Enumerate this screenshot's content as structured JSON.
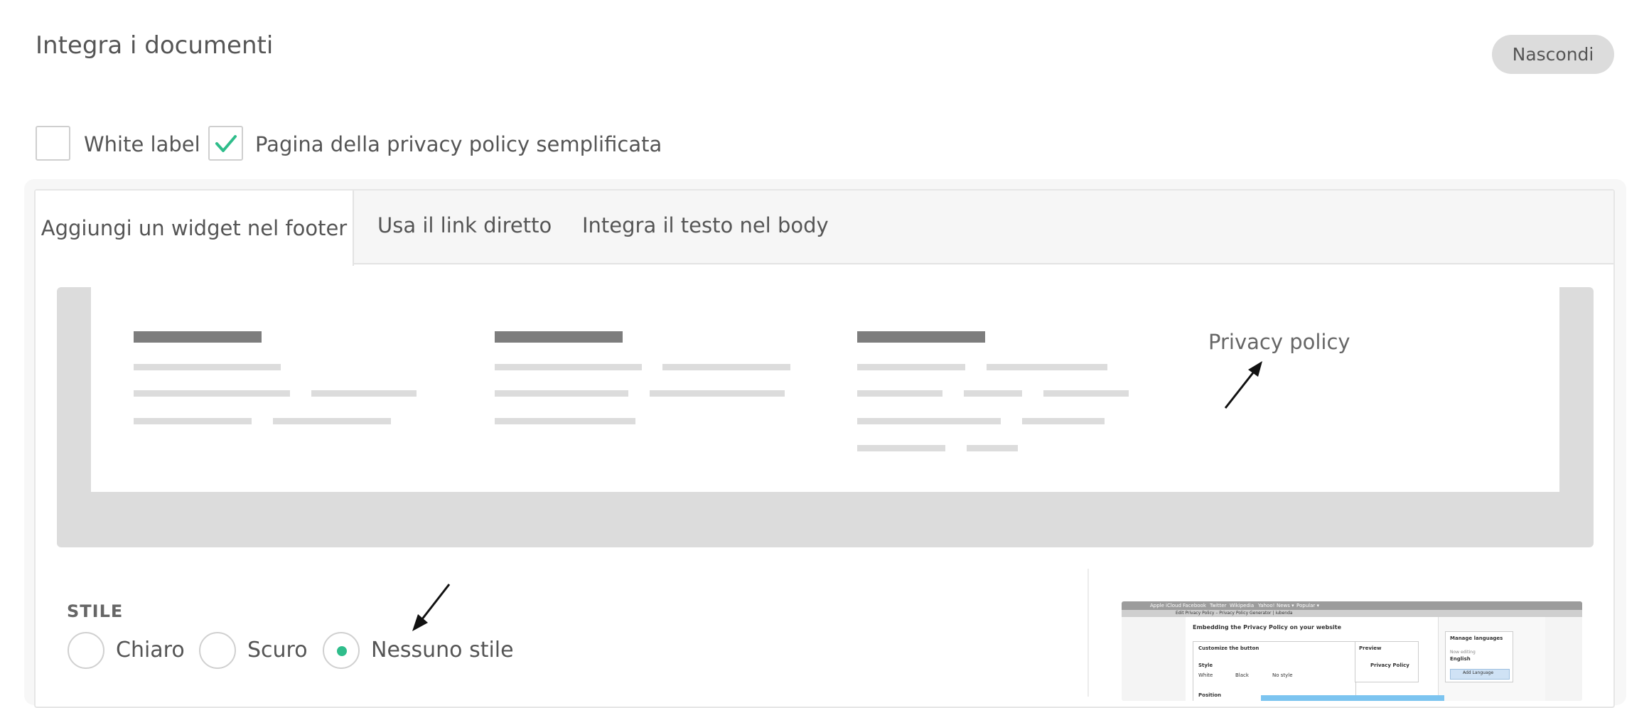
{
  "header": {
    "title": "Integra i documenti",
    "hide_label": "Nascondi"
  },
  "options": {
    "white_label": {
      "label": "White label",
      "checked": false
    },
    "simplified_policy": {
      "label": "Pagina della privacy policy semplificata",
      "checked": true
    }
  },
  "tabs": [
    {
      "label": "Aggiungi un widget nel footer",
      "active": true
    },
    {
      "label": "Usa il link diretto",
      "active": false
    },
    {
      "label": "Integra il testo nel body",
      "active": false
    }
  ],
  "footer_preview": {
    "link_text": "Privacy policy"
  },
  "style": {
    "title": "STILE",
    "options": [
      {
        "label": "Chiaro",
        "selected": false
      },
      {
        "label": "Scuro",
        "selected": false
      },
      {
        "label": "Nessuno stile",
        "selected": true
      }
    ]
  },
  "thumbnail": {
    "menubar_items": [
      "Apple",
      "iCloud",
      "Facebook",
      "Twitter",
      "Wikipedia",
      "Yahoo!",
      "News ▾",
      "Popular ▾"
    ],
    "tab_title": "Edit Privacy Policy – Privacy Policy Generator | iubenda",
    "heading": "Embedding the Privacy Policy on your website",
    "customize_label": "Customize the button",
    "style_label": "Style",
    "style_options": [
      "White",
      "Black",
      "No style"
    ],
    "position_label": "Position",
    "preview_label": "Preview",
    "preview_link": "Privacy Policy",
    "manage_languages": "Manage languages",
    "now_editing_label": "Now editing",
    "now_editing_value": "English",
    "add_language": "Add Language"
  },
  "colors": {
    "accent": "#2fbd8b",
    "text": "#555555",
    "button_bg": "#dcdcdc"
  }
}
